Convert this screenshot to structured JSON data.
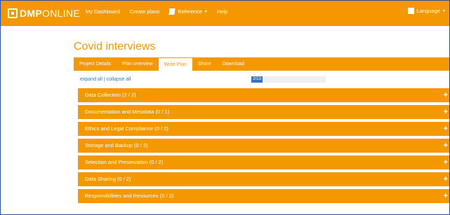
{
  "header": {
    "logo_bold": "DMP",
    "logo_light": "ONLINE",
    "nav": {
      "dashboard": "My Dashboard",
      "create": "Create plans",
      "reference": "Reference",
      "help": "Help"
    },
    "language": "Language"
  },
  "page": {
    "title": "Covid interviews"
  },
  "tabs": [
    "Project Details",
    "Plan overview",
    "Write Plan",
    "Share",
    "Download"
  ],
  "controls": {
    "expand_all": "expand all",
    "separator": " | ",
    "collapse_all": "collapse all"
  },
  "progress": {
    "label": "2/13",
    "value": 2,
    "total": 13
  },
  "sections": [
    "Data Collection (2 / 2)",
    "Documentation and Metadata (0 / 1)",
    "Ethics and Legal Compliance (0 / 2)",
    "Storage and Backup (0 / 2)",
    "Selection and Preservation (0 / 2)",
    "Data Sharing (0 / 2)",
    "Responsibilities and Resources (0 / 2)"
  ],
  "icons": {
    "expand": "plus-icon",
    "reference": "book-icon",
    "language": "flag-icon",
    "logo": "logo-icon"
  },
  "colors": {
    "brand": "#f39800",
    "progress": "#3a74b2",
    "link": "#2b7bb9"
  }
}
